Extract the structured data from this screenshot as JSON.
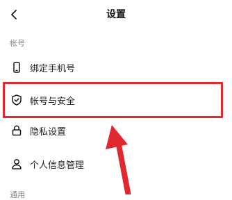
{
  "header": {
    "title": "设置",
    "back_icon": "chevron-left-icon"
  },
  "sections": [
    {
      "label": "帐号"
    },
    {
      "label": "通用"
    }
  ],
  "items": [
    {
      "label": "绑定手机号",
      "icon": "phone-icon"
    },
    {
      "label": "帐号与安全",
      "icon": "shield-check-icon"
    },
    {
      "label": "隐私设置",
      "icon": "lock-icon"
    },
    {
      "label": "个人信息管理",
      "icon": "person-icon"
    }
  ],
  "annotation": {
    "color": "#e0282e",
    "target": "帐号与安全"
  }
}
